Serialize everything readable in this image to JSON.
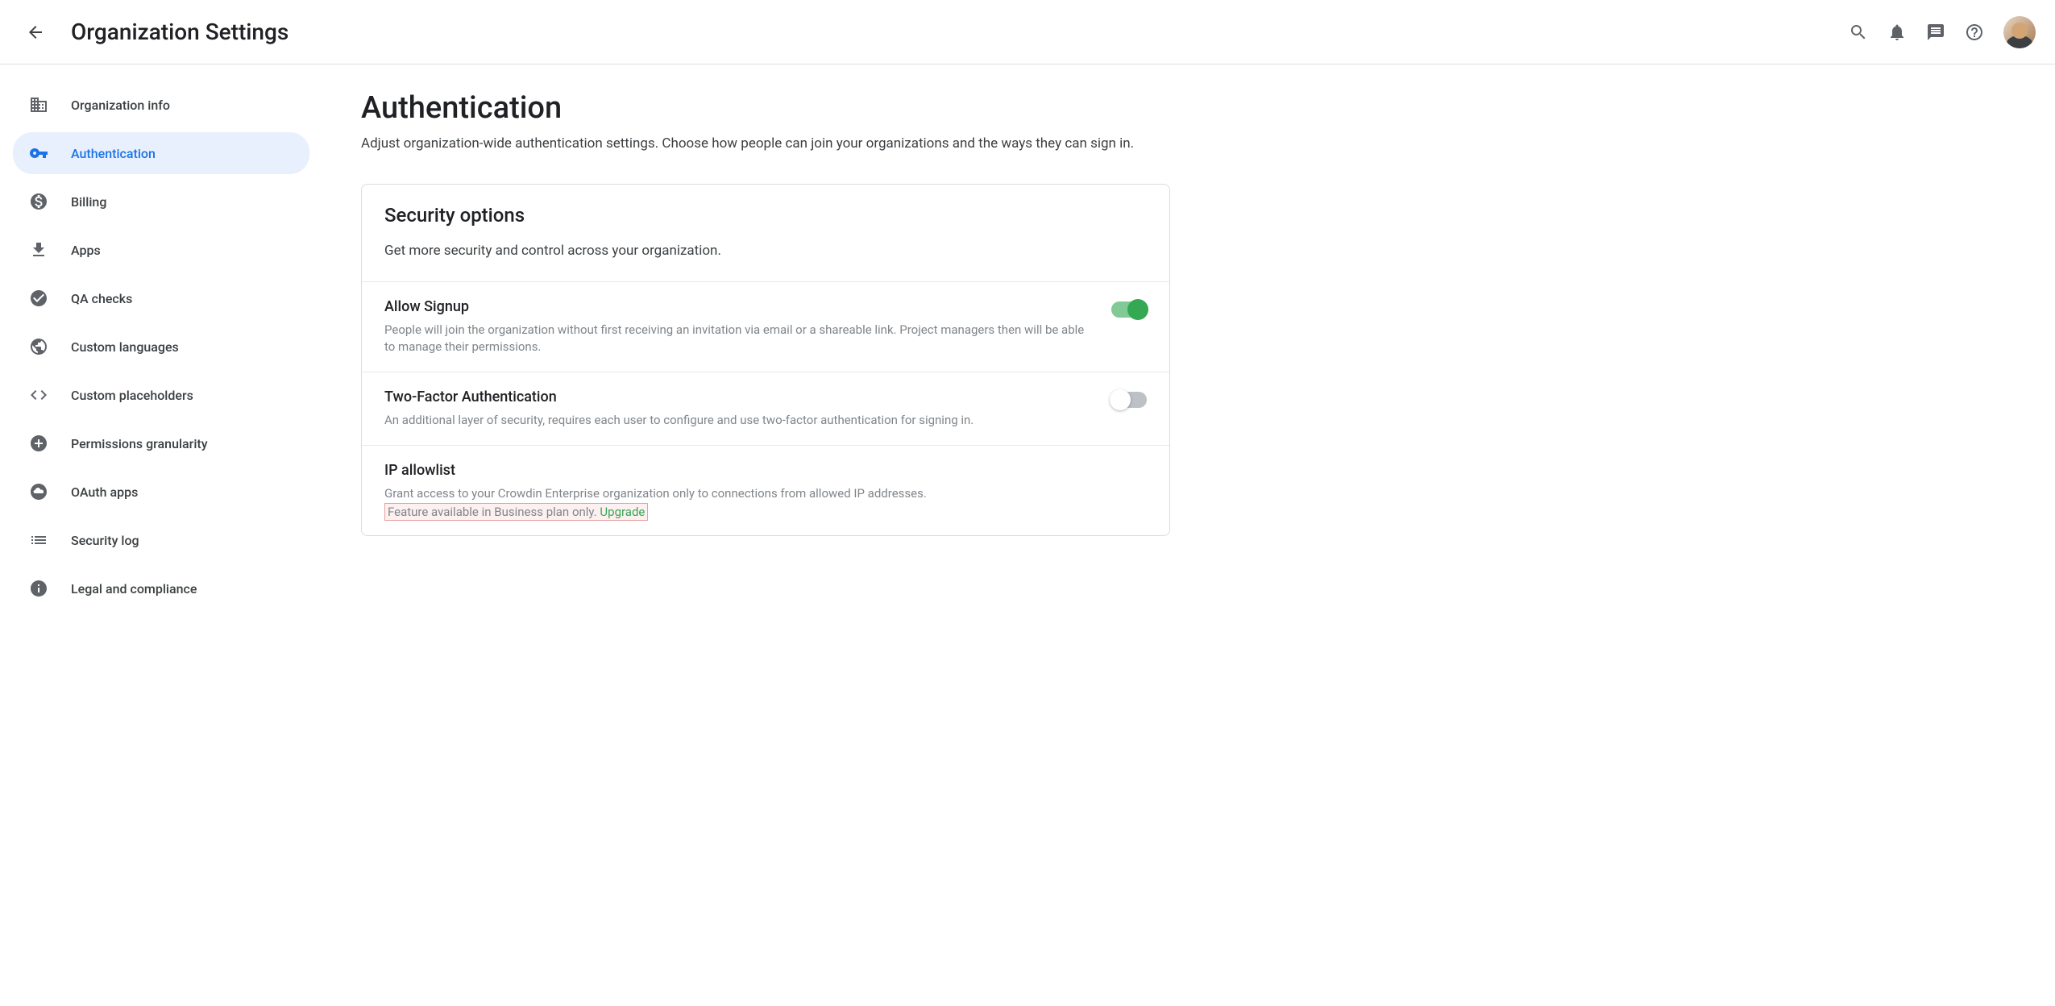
{
  "header": {
    "title": "Organization Settings"
  },
  "sidebar": {
    "items": [
      {
        "label": "Organization info"
      },
      {
        "label": "Authentication"
      },
      {
        "label": "Billing"
      },
      {
        "label": "Apps"
      },
      {
        "label": "QA checks"
      },
      {
        "label": "Custom languages"
      },
      {
        "label": "Custom placeholders"
      },
      {
        "label": "Permissions granularity"
      },
      {
        "label": "OAuth apps"
      },
      {
        "label": "Security log"
      },
      {
        "label": "Legal and compliance"
      }
    ]
  },
  "main": {
    "title": "Authentication",
    "subtitle": "Adjust organization-wide authentication settings. Choose how people can join your organizations and the ways they can sign in.",
    "card": {
      "title": "Security options",
      "subtitle": "Get more security and control across your organization.",
      "options": [
        {
          "title": "Allow Signup",
          "desc": "People will join the organization without first receiving an invitation via email or a shareable link. Project managers then will be able to manage their permissions.",
          "toggle": true
        },
        {
          "title": "Two-Factor Authentication",
          "desc": "An additional layer of security, requires each user to configure and use two-factor authentication for signing in.",
          "toggle": false
        },
        {
          "title": "IP allowlist",
          "desc": "Grant access to your Crowdin Enterprise organization only to connections from allowed IP addresses.",
          "notice_text": "Feature available in Business plan only. ",
          "notice_link": "Upgrade"
        }
      ]
    }
  }
}
